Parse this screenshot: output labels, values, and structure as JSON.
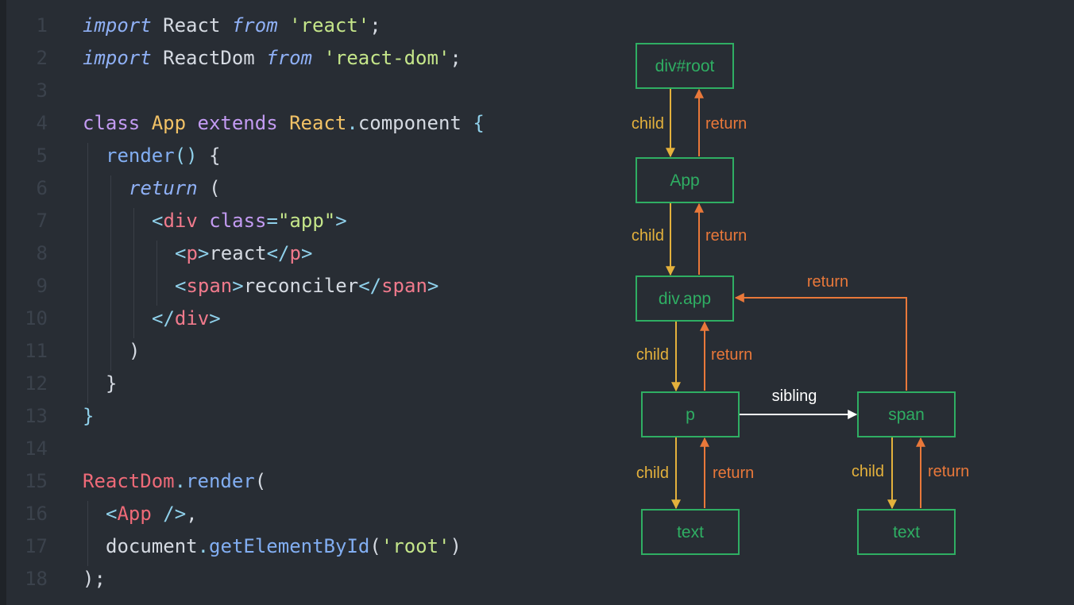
{
  "code": {
    "lines": [
      {
        "n": "1",
        "indent": 0,
        "tokens": [
          {
            "t": "import",
            "c": "kw-i"
          },
          {
            "t": " React ",
            "c": "plain"
          },
          {
            "t": "from",
            "c": "kw-i"
          },
          {
            "t": " 'react'",
            "c": "str"
          },
          {
            "t": ";",
            "c": "plain"
          }
        ]
      },
      {
        "n": "2",
        "indent": 0,
        "tokens": [
          {
            "t": "import",
            "c": "kw-i"
          },
          {
            "t": " ReactDom ",
            "c": "plain"
          },
          {
            "t": "from",
            "c": "kw-i"
          },
          {
            "t": " 'react-dom'",
            "c": "str"
          },
          {
            "t": ";",
            "c": "plain"
          }
        ]
      },
      {
        "n": "3",
        "indent": 0,
        "tokens": []
      },
      {
        "n": "4",
        "indent": 0,
        "tokens": [
          {
            "t": "class",
            "c": "kw"
          },
          {
            "t": " App ",
            "c": "cls"
          },
          {
            "t": "extends",
            "c": "kw"
          },
          {
            "t": " React",
            "c": "cls"
          },
          {
            "t": ".",
            "c": "punc"
          },
          {
            "t": "component ",
            "c": "plain"
          },
          {
            "t": "{",
            "c": "punc"
          }
        ]
      },
      {
        "n": "5",
        "indent": 1,
        "tokens": [
          {
            "t": "render",
            "c": "fn"
          },
          {
            "t": "() ",
            "c": "punc"
          },
          {
            "t": "{",
            "c": "plain"
          }
        ]
      },
      {
        "n": "6",
        "indent": 2,
        "tokens": [
          {
            "t": "return",
            "c": "kw-i"
          },
          {
            "t": " (",
            "c": "plain"
          }
        ]
      },
      {
        "n": "7",
        "indent": 3,
        "tokens": [
          {
            "t": "<",
            "c": "punc"
          },
          {
            "t": "div",
            "c": "tag"
          },
          {
            "t": " class",
            "c": "attr"
          },
          {
            "t": "=",
            "c": "punc"
          },
          {
            "t": "\"app\"",
            "c": "str"
          },
          {
            "t": ">",
            "c": "punc"
          }
        ]
      },
      {
        "n": "8",
        "indent": 4,
        "tokens": [
          {
            "t": "<",
            "c": "punc"
          },
          {
            "t": "p",
            "c": "tag"
          },
          {
            "t": ">",
            "c": "punc"
          },
          {
            "t": "react",
            "c": "plain"
          },
          {
            "t": "</",
            "c": "punc"
          },
          {
            "t": "p",
            "c": "tag"
          },
          {
            "t": ">",
            "c": "punc"
          }
        ]
      },
      {
        "n": "9",
        "indent": 4,
        "tokens": [
          {
            "t": "<",
            "c": "punc"
          },
          {
            "t": "span",
            "c": "tag"
          },
          {
            "t": ">",
            "c": "punc"
          },
          {
            "t": "reconciler",
            "c": "plain"
          },
          {
            "t": "</",
            "c": "punc"
          },
          {
            "t": "span",
            "c": "tag"
          },
          {
            "t": ">",
            "c": "punc"
          }
        ]
      },
      {
        "n": "10",
        "indent": 3,
        "tokens": [
          {
            "t": "</",
            "c": "punc"
          },
          {
            "t": "div",
            "c": "tag"
          },
          {
            "t": ">",
            "c": "punc"
          }
        ]
      },
      {
        "n": "11",
        "indent": 2,
        "tokens": [
          {
            "t": ")",
            "c": "plain"
          }
        ]
      },
      {
        "n": "12",
        "indent": 1,
        "tokens": [
          {
            "t": "}",
            "c": "plain"
          }
        ]
      },
      {
        "n": "13",
        "indent": 0,
        "tokens": [
          {
            "t": "}",
            "c": "punc"
          }
        ]
      },
      {
        "n": "14",
        "indent": 0,
        "tokens": []
      },
      {
        "n": "15",
        "indent": 0,
        "tokens": [
          {
            "t": "ReactDom",
            "c": "var"
          },
          {
            "t": ".",
            "c": "punc"
          },
          {
            "t": "render",
            "c": "fn"
          },
          {
            "t": "(",
            "c": "plain"
          }
        ]
      },
      {
        "n": "16",
        "indent": 1,
        "tokens": [
          {
            "t": "<",
            "c": "punc"
          },
          {
            "t": "App",
            "c": "var"
          },
          {
            "t": " />",
            "c": "punc"
          },
          {
            "t": ",",
            "c": "plain"
          }
        ]
      },
      {
        "n": "17",
        "indent": 1,
        "tokens": [
          {
            "t": "document",
            "c": "plain"
          },
          {
            "t": ".",
            "c": "punc"
          },
          {
            "t": "getElementById",
            "c": "fn"
          },
          {
            "t": "(",
            "c": "plain"
          },
          {
            "t": "'root'",
            "c": "str"
          },
          {
            "t": ")",
            "c": "plain"
          }
        ]
      },
      {
        "n": "18",
        "indent": 0,
        "tokens": [
          {
            "t": ")",
            "c": "plain"
          },
          {
            "t": ";",
            "c": "plain"
          }
        ]
      }
    ],
    "colors": {
      "kw-i": "#8fb0f5",
      "kw": "#c39bf2",
      "cls": "#f2c266",
      "punc": "#8fd0ea",
      "fn": "#82aef2",
      "str": "#c5e68a",
      "tag": "#f07a8c",
      "attr": "#c39bf2",
      "var": "#ee6a78",
      "plain": "#d5dae2"
    }
  },
  "diagram": {
    "colors": {
      "node": "#2fae63",
      "child": "#e4b13c",
      "return": "#e9783a",
      "sibling": "#ffffff"
    },
    "nodes": [
      {
        "id": "root",
        "label": "div#root"
      },
      {
        "id": "app",
        "label": "App"
      },
      {
        "id": "divapp",
        "label": "div.app"
      },
      {
        "id": "p",
        "label": "p"
      },
      {
        "id": "span",
        "label": "span"
      },
      {
        "id": "ptext",
        "label": "text"
      },
      {
        "id": "spantext",
        "label": "text"
      }
    ],
    "edges": [
      {
        "id": "root-app-child",
        "from": "root",
        "to": "app",
        "kind": "child",
        "label": "child"
      },
      {
        "id": "app-root-return",
        "from": "app",
        "to": "root",
        "kind": "return",
        "label": "return"
      },
      {
        "id": "app-divapp-child",
        "from": "app",
        "to": "divapp",
        "kind": "child",
        "label": "child"
      },
      {
        "id": "divapp-app-return",
        "from": "divapp",
        "to": "app",
        "kind": "return",
        "label": "return"
      },
      {
        "id": "divapp-p-child",
        "from": "divapp",
        "to": "p",
        "kind": "child",
        "label": "child"
      },
      {
        "id": "p-divapp-return",
        "from": "p",
        "to": "divapp",
        "kind": "return",
        "label": "return"
      },
      {
        "id": "p-span-sibling",
        "from": "p",
        "to": "span",
        "kind": "sibling",
        "label": "sibling"
      },
      {
        "id": "span-divapp-return",
        "from": "span",
        "to": "divapp",
        "kind": "return",
        "label": "return"
      },
      {
        "id": "p-ptext-child",
        "from": "p",
        "to": "ptext",
        "kind": "child",
        "label": "child"
      },
      {
        "id": "ptext-p-return",
        "from": "ptext",
        "to": "p",
        "kind": "return",
        "label": "return"
      },
      {
        "id": "span-spantext-child",
        "from": "span",
        "to": "spantext",
        "kind": "child",
        "label": "child"
      },
      {
        "id": "spantext-span-return",
        "from": "spantext",
        "to": "span",
        "kind": "return",
        "label": "return"
      }
    ]
  }
}
